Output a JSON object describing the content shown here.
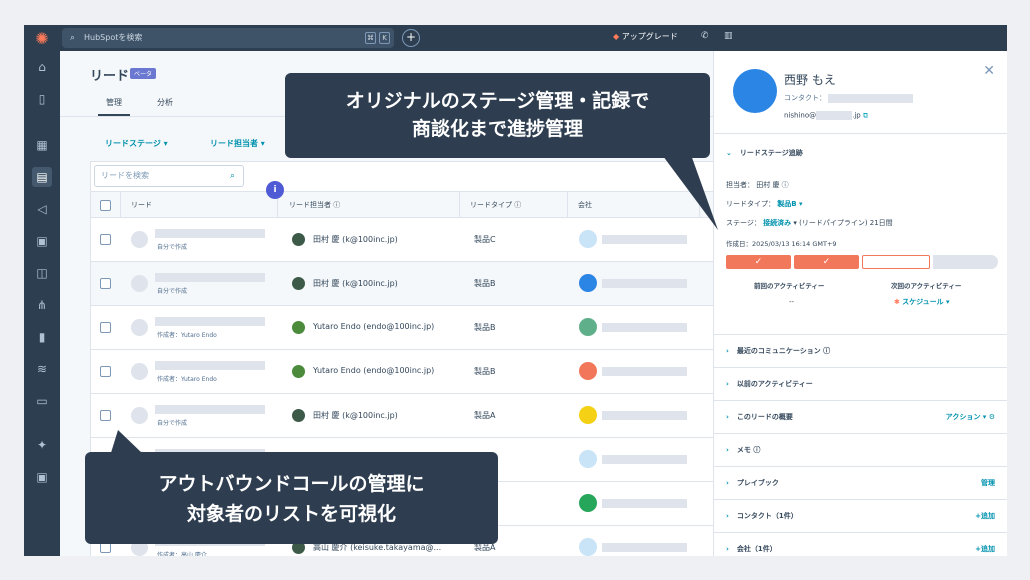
{
  "topbar": {
    "search_placeholder": "HubSpotを検索",
    "kbd_1": "⌘",
    "kbd_2": "K",
    "plus_icon": "+",
    "upgrade_label": "アップグレード"
  },
  "page": {
    "title": "リード",
    "beta_badge": "ベータ",
    "tabs": [
      {
        "label": "管理"
      },
      {
        "label": "分析"
      }
    ],
    "filters": [
      {
        "label": "リードステージ ▾"
      },
      {
        "label": "リード担当者 ▾"
      }
    ]
  },
  "table": {
    "search_placeholder": "リードを検索",
    "columns": [
      {
        "label": "リード"
      },
      {
        "label": "リード担当者 ⓘ"
      },
      {
        "label": "リードタイプ ⓘ"
      },
      {
        "label": "会社"
      }
    ],
    "rows": [
      {
        "sub": "自分で作成",
        "owner": "田村 慶 (k@100inc.jp)",
        "type": "製品C",
        "company_color": "#c9e3f7"
      },
      {
        "sub": "自分で作成",
        "owner": "田村 慶 (k@100inc.jp)",
        "type": "製品B",
        "company_color": "#2b85e4"
      },
      {
        "sub": "作成者：Yutaro Endo",
        "owner": "Yutaro Endo (endo@100inc.jp)",
        "type": "製品B",
        "company_color": "#5fb08a"
      },
      {
        "sub": "作成者：Yutaro Endo",
        "owner": "Yutaro Endo (endo@100inc.jp)",
        "type": "製品B",
        "company_color": "#f2765a"
      },
      {
        "sub": "自分で作成",
        "owner": "田村 慶 (k@100inc.jp)",
        "type": "製品A",
        "company_color": "#f5d116"
      },
      {
        "sub": "",
        "owner": "",
        "type": "",
        "company_color": "#c9e3f7"
      },
      {
        "sub": "",
        "owner": "",
        "type": "",
        "company_color": "#26a65b"
      },
      {
        "sub": "作成者：高山 慶介",
        "owner": "高山 慶介 (keisuke.takayama@...",
        "type": "製品A",
        "company_color": "#c9e3f7"
      }
    ],
    "info_bubble": "i"
  },
  "panel": {
    "name": "西野 もえ",
    "contact_label": "コンタクト：",
    "email_prefix": "nishino@",
    "email_suffix": ".jp",
    "close_icon": "✕",
    "stage_tracker_title": "リードステージ追跡",
    "owner_label": "担当者： 田村 慶 ⓘ",
    "type_label": "リードタイプ：",
    "type_value": "製品B ▾",
    "stage_label": "ステージ：",
    "stage_value": "接続済み",
    "stage_rest": "▾ (リードパイプライン) 21日間",
    "created": "作成日：2025/03/13 16:14 GMT+9",
    "check": "✓",
    "prev_activity_label": "前回のアクティビティー",
    "prev_activity_value": "--",
    "next_activity_label": "次回のアクティビティー",
    "next_activity_value": "スケジュール ▾",
    "sections": [
      {
        "label": "最近のコミュニケーション ⓘ",
        "action": ""
      },
      {
        "label": "以前のアクティビティー",
        "action": ""
      },
      {
        "label": "このリードの概要",
        "action": "アクション ▾  ⚙"
      },
      {
        "label": "メモ ⓘ",
        "action": ""
      },
      {
        "label": "プレイブック",
        "action": "管理"
      },
      {
        "label": "コンタクト（1件）",
        "action": "+追加"
      },
      {
        "label": "会社（1件）",
        "action": "+追加"
      }
    ]
  },
  "callouts": {
    "top_line1": "オリジナルのステージ管理・記録で",
    "top_line2": "商談化まで進捗管理",
    "bottom_line1": "アウトバウンドコールの管理に",
    "bottom_line2": "対象者のリストを可視化"
  }
}
